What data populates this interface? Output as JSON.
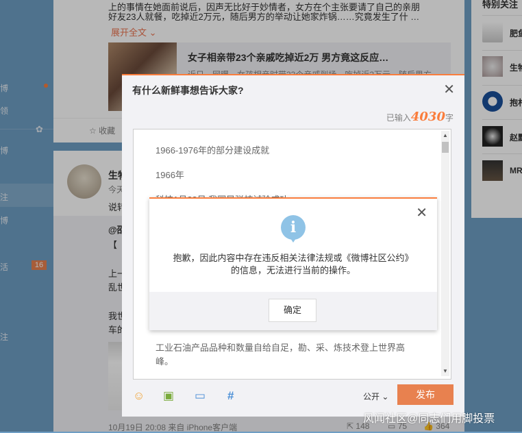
{
  "nav": {
    "items": [
      {
        "label": "博",
        "dot": true
      },
      {
        "label": "领",
        "dot": false
      },
      {
        "label": "博",
        "dot": false
      },
      {
        "label": "注",
        "dot": false
      },
      {
        "label": "博",
        "dot": false
      },
      {
        "label": "活",
        "dot": false,
        "badge": "16"
      },
      {
        "label": "注",
        "dot": false
      }
    ]
  },
  "feed": {
    "post1": {
      "text_line1": "上的事情在她面前说后，因声无比好于妙情者，女方在个主张要请了自己的亲朋",
      "text_line2": "好友23人就餐，吃掉近2万元，随后男方的举动让她家炸锅……究竟发生了什 …",
      "expand": "展开全文",
      "link_title": "女子相亲带23个亲戚吃掉近2万 男方竟这反应…",
      "link_snippet": "近日，网曝一女孩相亲时带23个亲戚到场，吃掉近2万元，随后男方",
      "collect": "收藏"
    },
    "post2": {
      "author": "生物",
      "time_prefix": "今天",
      "source_prefix": "说转",
      "mention": "@邵",
      "bracket": "【",
      "line_a": "上一",
      "line_b": "乱世",
      "line_c": "我世",
      "line_d": "车的",
      "footer_time": "10月19日 20:08 来自 iPhone客户端",
      "repost_count": "148",
      "comment_count": "75",
      "like_count": "364"
    }
  },
  "composer": {
    "title": "有什么新鲜事想告诉大家?",
    "count_prefix": "已输入",
    "count_value": "4030",
    "count_suffix": "字",
    "para1": "1966-1976年的部分建设成就",
    "para2": "1966年",
    "para3": "科技1月28日 我国导弹核试验成功",
    "para4": "工业石油产品品种和数量自给自足，勘、采、炼技术登上世界高",
    "para5": "峰。",
    "public_label": "公开",
    "publish_label": "发布",
    "tools": [
      "emoji-icon",
      "image-icon",
      "video-icon",
      "topic-icon"
    ]
  },
  "alert": {
    "message": "抱歉，因此内容中存在违反相关法律法规或《微博社区公约》的信息，无法进行当前的操作。",
    "ok_label": "确定"
  },
  "right": {
    "title": "特别关注",
    "users": [
      {
        "name": "肥鱼"
      },
      {
        "name": "生物"
      },
      {
        "name": "抱朴"
      },
      {
        "name": "赵默"
      },
      {
        "name": "MR"
      }
    ]
  },
  "watermark": "风闻社区@同志们用脚投票",
  "colors": {
    "accent": "#fa7d3c",
    "background": "#6e9ec4",
    "publish": "#e8814f",
    "info_icon": "#8fc3e6"
  }
}
